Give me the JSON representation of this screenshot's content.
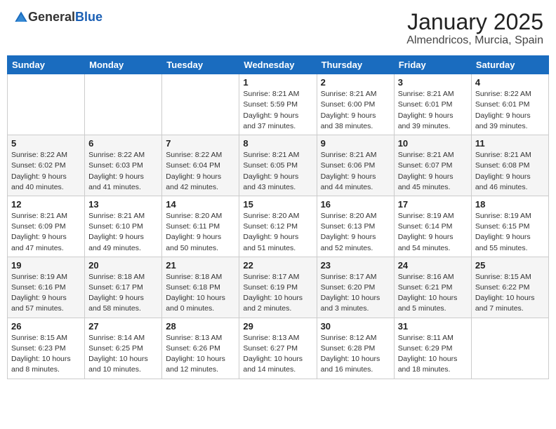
{
  "header": {
    "logo_general": "General",
    "logo_blue": "Blue",
    "month": "January 2025",
    "location": "Almendricos, Murcia, Spain"
  },
  "weekdays": [
    "Sunday",
    "Monday",
    "Tuesday",
    "Wednesday",
    "Thursday",
    "Friday",
    "Saturday"
  ],
  "weeks": [
    [
      {
        "day": "",
        "info": ""
      },
      {
        "day": "",
        "info": ""
      },
      {
        "day": "",
        "info": ""
      },
      {
        "day": "1",
        "info": "Sunrise: 8:21 AM\nSunset: 5:59 PM\nDaylight: 9 hours\nand 37 minutes."
      },
      {
        "day": "2",
        "info": "Sunrise: 8:21 AM\nSunset: 6:00 PM\nDaylight: 9 hours\nand 38 minutes."
      },
      {
        "day": "3",
        "info": "Sunrise: 8:21 AM\nSunset: 6:01 PM\nDaylight: 9 hours\nand 39 minutes."
      },
      {
        "day": "4",
        "info": "Sunrise: 8:22 AM\nSunset: 6:01 PM\nDaylight: 9 hours\nand 39 minutes."
      }
    ],
    [
      {
        "day": "5",
        "info": "Sunrise: 8:22 AM\nSunset: 6:02 PM\nDaylight: 9 hours\nand 40 minutes."
      },
      {
        "day": "6",
        "info": "Sunrise: 8:22 AM\nSunset: 6:03 PM\nDaylight: 9 hours\nand 41 minutes."
      },
      {
        "day": "7",
        "info": "Sunrise: 8:22 AM\nSunset: 6:04 PM\nDaylight: 9 hours\nand 42 minutes."
      },
      {
        "day": "8",
        "info": "Sunrise: 8:21 AM\nSunset: 6:05 PM\nDaylight: 9 hours\nand 43 minutes."
      },
      {
        "day": "9",
        "info": "Sunrise: 8:21 AM\nSunset: 6:06 PM\nDaylight: 9 hours\nand 44 minutes."
      },
      {
        "day": "10",
        "info": "Sunrise: 8:21 AM\nSunset: 6:07 PM\nDaylight: 9 hours\nand 45 minutes."
      },
      {
        "day": "11",
        "info": "Sunrise: 8:21 AM\nSunset: 6:08 PM\nDaylight: 9 hours\nand 46 minutes."
      }
    ],
    [
      {
        "day": "12",
        "info": "Sunrise: 8:21 AM\nSunset: 6:09 PM\nDaylight: 9 hours\nand 47 minutes."
      },
      {
        "day": "13",
        "info": "Sunrise: 8:21 AM\nSunset: 6:10 PM\nDaylight: 9 hours\nand 49 minutes."
      },
      {
        "day": "14",
        "info": "Sunrise: 8:20 AM\nSunset: 6:11 PM\nDaylight: 9 hours\nand 50 minutes."
      },
      {
        "day": "15",
        "info": "Sunrise: 8:20 AM\nSunset: 6:12 PM\nDaylight: 9 hours\nand 51 minutes."
      },
      {
        "day": "16",
        "info": "Sunrise: 8:20 AM\nSunset: 6:13 PM\nDaylight: 9 hours\nand 52 minutes."
      },
      {
        "day": "17",
        "info": "Sunrise: 8:19 AM\nSunset: 6:14 PM\nDaylight: 9 hours\nand 54 minutes."
      },
      {
        "day": "18",
        "info": "Sunrise: 8:19 AM\nSunset: 6:15 PM\nDaylight: 9 hours\nand 55 minutes."
      }
    ],
    [
      {
        "day": "19",
        "info": "Sunrise: 8:19 AM\nSunset: 6:16 PM\nDaylight: 9 hours\nand 57 minutes."
      },
      {
        "day": "20",
        "info": "Sunrise: 8:18 AM\nSunset: 6:17 PM\nDaylight: 9 hours\nand 58 minutes."
      },
      {
        "day": "21",
        "info": "Sunrise: 8:18 AM\nSunset: 6:18 PM\nDaylight: 10 hours\nand 0 minutes."
      },
      {
        "day": "22",
        "info": "Sunrise: 8:17 AM\nSunset: 6:19 PM\nDaylight: 10 hours\nand 2 minutes."
      },
      {
        "day": "23",
        "info": "Sunrise: 8:17 AM\nSunset: 6:20 PM\nDaylight: 10 hours\nand 3 minutes."
      },
      {
        "day": "24",
        "info": "Sunrise: 8:16 AM\nSunset: 6:21 PM\nDaylight: 10 hours\nand 5 minutes."
      },
      {
        "day": "25",
        "info": "Sunrise: 8:15 AM\nSunset: 6:22 PM\nDaylight: 10 hours\nand 7 minutes."
      }
    ],
    [
      {
        "day": "26",
        "info": "Sunrise: 8:15 AM\nSunset: 6:23 PM\nDaylight: 10 hours\nand 8 minutes."
      },
      {
        "day": "27",
        "info": "Sunrise: 8:14 AM\nSunset: 6:25 PM\nDaylight: 10 hours\nand 10 minutes."
      },
      {
        "day": "28",
        "info": "Sunrise: 8:13 AM\nSunset: 6:26 PM\nDaylight: 10 hours\nand 12 minutes."
      },
      {
        "day": "29",
        "info": "Sunrise: 8:13 AM\nSunset: 6:27 PM\nDaylight: 10 hours\nand 14 minutes."
      },
      {
        "day": "30",
        "info": "Sunrise: 8:12 AM\nSunset: 6:28 PM\nDaylight: 10 hours\nand 16 minutes."
      },
      {
        "day": "31",
        "info": "Sunrise: 8:11 AM\nSunset: 6:29 PM\nDaylight: 10 hours\nand 18 minutes."
      },
      {
        "day": "",
        "info": ""
      }
    ]
  ]
}
